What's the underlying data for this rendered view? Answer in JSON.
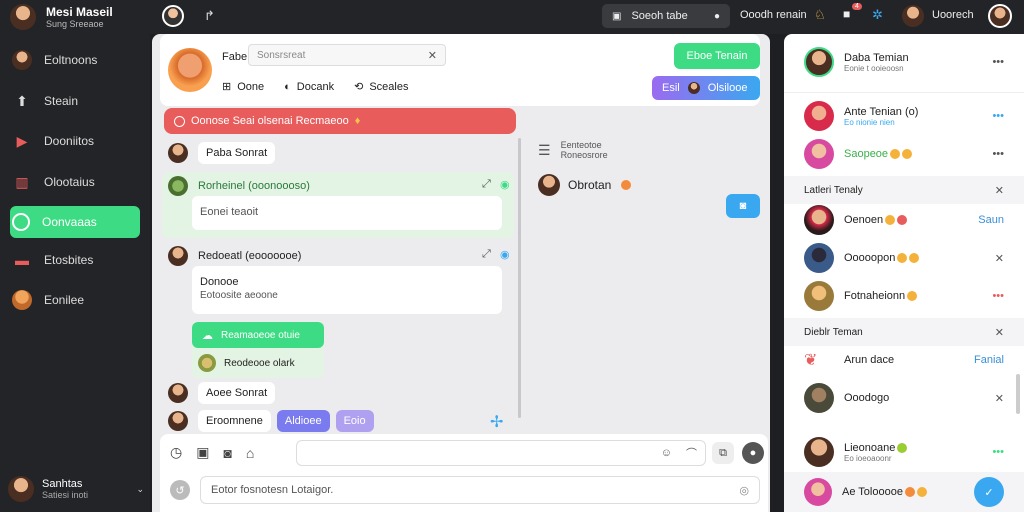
{
  "colors": {
    "accent_green": "#3ddc84",
    "accent_blue": "#3aa8f0",
    "accent_red": "#e85c5c",
    "accent_purple": "#7b7bf0"
  },
  "topbar": {
    "user_name": "Mesi Maseil",
    "user_status": "Sung Sreeaoe",
    "search_label": "Soeoh tabe",
    "nav_label": "Ooodh renain",
    "badge_count": "4",
    "right_label": "Uoorech"
  },
  "sidebar": {
    "items": [
      {
        "label": "Eoltnoons",
        "icon": "avatar"
      },
      {
        "label": "Steain",
        "icon": "home-icon"
      },
      {
        "label": "Dooniitos",
        "icon": "play-icon"
      },
      {
        "label": "Olootaius",
        "icon": "chart-icon"
      },
      {
        "label": "Oonvaaas",
        "icon": "chat-icon"
      },
      {
        "label": "Etosbites",
        "icon": "box-icon"
      },
      {
        "label": "Eonilee",
        "icon": "avatar"
      }
    ],
    "footer_name": "Sanhtas",
    "footer_sub": "Satiesi inoti"
  },
  "chat_header": {
    "title": "Fabe",
    "search_placeholder": "Sonsrsreat",
    "tabs": [
      "Oone",
      "Docank",
      "Sceales"
    ],
    "btn_primary": "Eboe Tenain",
    "btn_secondary_a": "Esil",
    "btn_secondary_b": "Olsilooe"
  },
  "alert": {
    "text": "Oonose Seai olsenai Recmaeoo"
  },
  "messages": [
    {
      "name": "Paba Sonrat"
    },
    {
      "name": "Rorheinel (ooonoooso)",
      "body": "Eonei teaoit"
    },
    {
      "name": "Redoeatl (eooooooe)",
      "body_title": "Donooe",
      "body_sub": "Eotoosite aeoone"
    },
    {
      "reply_title": "Reamaoeoe otuie",
      "reply_sub": "Reodeooe olark"
    },
    {
      "name": "Aoee Sonrat"
    },
    {
      "name": "Eroomnene",
      "tag_a": "Aldioee",
      "tag_b": "Eoio"
    }
  ],
  "thread": {
    "title": "Eenteotoe",
    "sub": "Roneosrore",
    "user": "Obrotan"
  },
  "composer": {
    "placeholder": "Eotor fosnotesn Lotaigor."
  },
  "right_panel": {
    "header": {
      "name": "Daba Temian",
      "sub": "Eonie t ooieoosn"
    },
    "rows_top": [
      {
        "name": "Ante Tenian (o)",
        "sub": "Eo nionie nien"
      },
      {
        "name": "Saopeoe"
      }
    ],
    "section1": "Latleri Tenaly",
    "rows_mid": [
      {
        "name": "Oenoen",
        "action": "Saun"
      },
      {
        "name": "Ooooopon"
      },
      {
        "name": "Fotnaheionn"
      }
    ],
    "section2": "Dieblr Teman",
    "rows_bot": [
      {
        "name": "Arun dace",
        "action": "Fanial"
      },
      {
        "name": "Ooodogo"
      },
      {
        "name": "Lieonoane",
        "sub": "Eo ioeoaoonr"
      }
    ],
    "footer": "Ae  Tolooooe"
  }
}
